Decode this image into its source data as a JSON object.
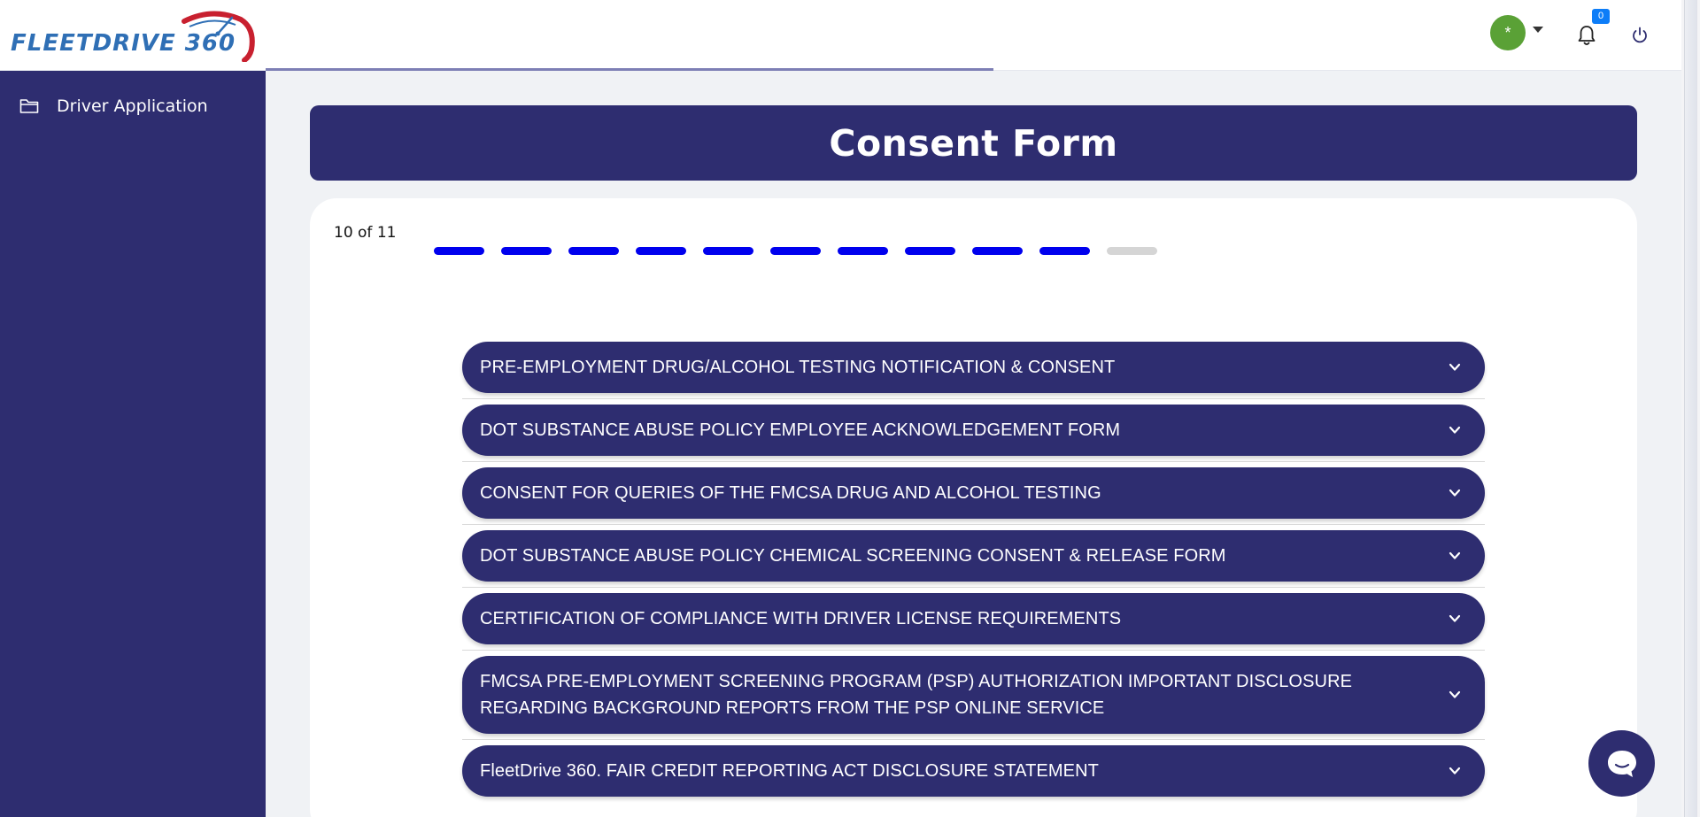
{
  "brand": {
    "logo_text": "FLEETDRIVE 360"
  },
  "header": {
    "avatar_initial": "*",
    "notifications_count": "0"
  },
  "sidebar": {
    "items": [
      {
        "label": "Driver Application",
        "icon": "folder-icon"
      }
    ]
  },
  "page": {
    "title": "Consent Form",
    "step_label": "10 of 11",
    "progress": {
      "current": 10,
      "total": 11
    }
  },
  "accordion": [
    {
      "label": "PRE-EMPLOYMENT DRUG/ALCOHOL TESTING NOTIFICATION & CONSENT"
    },
    {
      "label": "DOT SUBSTANCE ABUSE POLICY EMPLOYEE ACKNOWLEDGEMENT FORM"
    },
    {
      "label": "CONSENT FOR QUERIES OF THE FMCSA DRUG AND ALCOHOL TESTING"
    },
    {
      "label": "DOT SUBSTANCE ABUSE POLICY CHEMICAL SCREENING CONSENT & RELEASE FORM"
    },
    {
      "label": "CERTIFICATION OF COMPLIANCE WITH DRIVER LICENSE REQUIREMENTS"
    },
    {
      "label": "FMCSA PRE-EMPLOYMENT SCREENING PROGRAM (PSP) AUTHORIZATION IMPORTANT DISCLOSURE REGARDING BACKGROUND REPORTS FROM THE PSP ONLINE SERVICE"
    },
    {
      "label": "FleetDrive 360. FAIR CREDIT REPORTING ACT DISCLOSURE STATEMENT"
    }
  ],
  "colors": {
    "primary": "#2e2d70",
    "step_done": "#0000ee",
    "step_todo": "#d5d5d5",
    "avatar": "#5aa136",
    "badge": "#0d7df8",
    "logo_blue": "#2f6fb5",
    "logo_red": "#c8202f"
  }
}
